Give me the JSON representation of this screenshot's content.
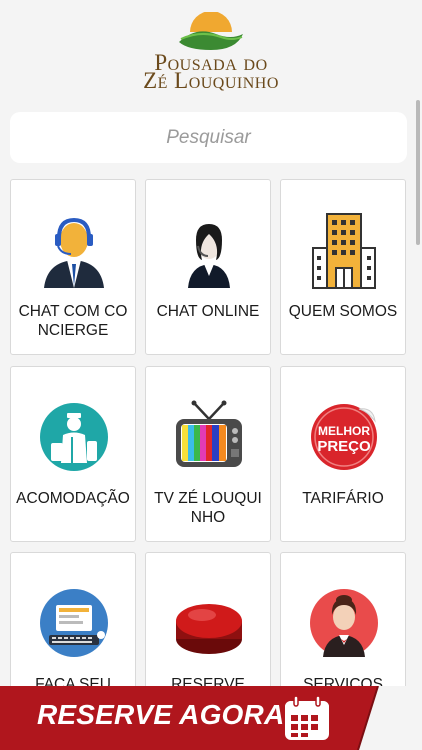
{
  "brand": {
    "line1": "Pousada do",
    "line2": "Zé Louquinho"
  },
  "search": {
    "placeholder": "Pesquisar"
  },
  "tiles": [
    {
      "label": "CHAT COM CONCIERGE",
      "icon": "concierge-headset-icon"
    },
    {
      "label": "CHAT ONLINE",
      "icon": "support-agent-icon"
    },
    {
      "label": "QUEM SOMOS",
      "icon": "hotel-building-icon"
    },
    {
      "label": "ACOMODAÇÃO",
      "icon": "bellboy-luggage-icon"
    },
    {
      "label": "TV ZÉ LOUQUINHO",
      "icon": "tv-icon"
    },
    {
      "label": "TARIFÁRIO",
      "icon": "best-price-sticker-icon"
    },
    {
      "label": "FAÇA SEU",
      "icon": "computer-reservation-icon"
    },
    {
      "label": "RESERVE",
      "icon": "red-button-icon"
    },
    {
      "label": "SERVIÇOS",
      "icon": "waitress-icon"
    }
  ],
  "sticker_text": {
    "line1": "MELHOR",
    "line2": "PREÇO"
  },
  "banner": {
    "label": "RESERVE AGORA!",
    "icon": "calendar-icon"
  },
  "colors": {
    "banner_red": "#b0161d",
    "brand_brown": "#6b4a1c",
    "banner_dark": "#8c0f14"
  }
}
